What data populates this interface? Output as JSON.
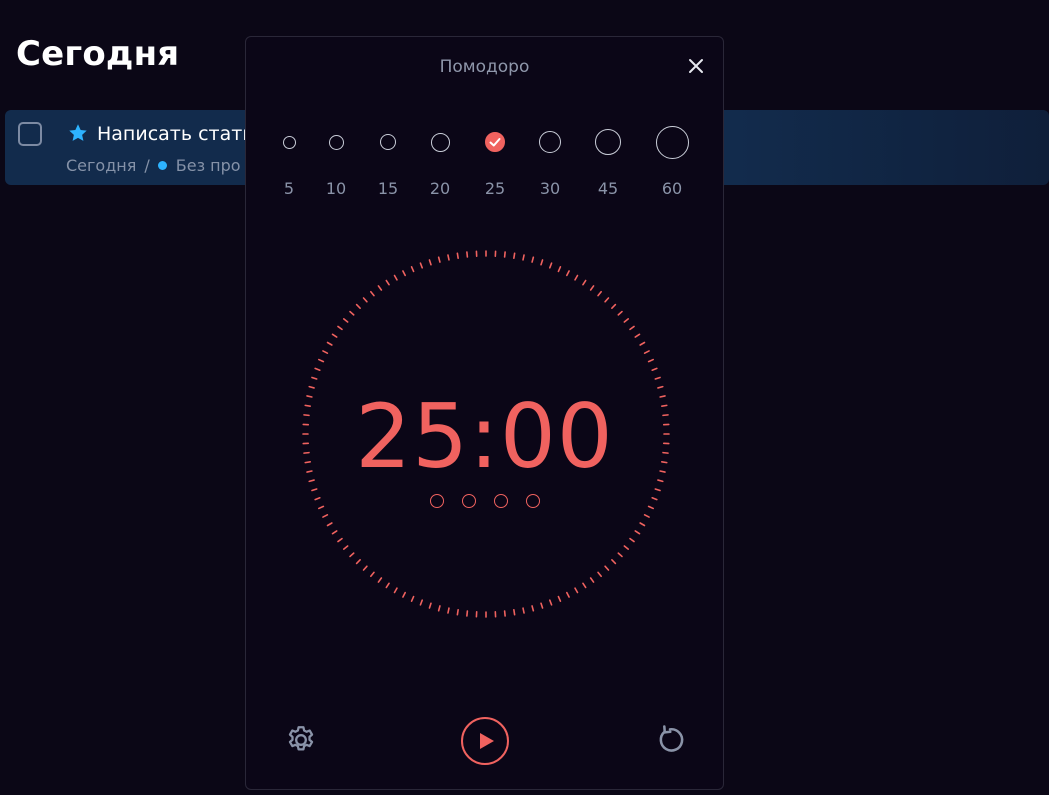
{
  "page": {
    "title": "Сегодня"
  },
  "task": {
    "title": "Написать стать",
    "meta_date": "Сегодня",
    "meta_separator": "/",
    "meta_project": "Без про",
    "star_color": "#2db3ff",
    "project_dot_color": "#2db3ff"
  },
  "modal": {
    "title": "Помодоро",
    "presets": [
      {
        "label": "5",
        "selected": false
      },
      {
        "label": "10",
        "selected": false
      },
      {
        "label": "15",
        "selected": false
      },
      {
        "label": "20",
        "selected": false
      },
      {
        "label": "25",
        "selected": true
      },
      {
        "label": "30",
        "selected": false
      },
      {
        "label": "45",
        "selected": false
      },
      {
        "label": "60",
        "selected": false
      }
    ],
    "time": "25:00",
    "sessions_total": 4,
    "sessions_completed": 0,
    "accent_color": "#f0625f",
    "icons": {
      "close": "close-icon",
      "settings": "gear-icon",
      "play": "play-icon",
      "reset": "reset-icon"
    }
  }
}
